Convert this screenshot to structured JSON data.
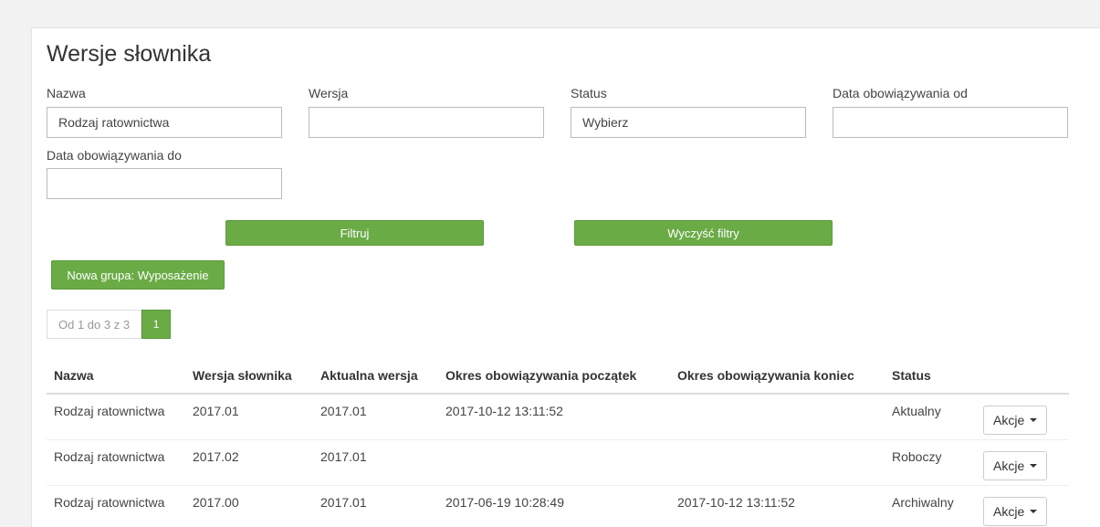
{
  "page_title": "Wersje słownika",
  "filters": {
    "nazwa_label": "Nazwa",
    "nazwa_value": "Rodzaj ratownictwa",
    "wersja_label": "Wersja",
    "wersja_value": "",
    "status_label": "Status",
    "status_value": "Wybierz",
    "od_label": "Data obowiązywania od",
    "od_value": "",
    "do_label": "Data obowiązywania do",
    "do_value": ""
  },
  "buttons": {
    "filter": "Filtruj",
    "clear": "Wyczyść filtry",
    "new_group": "Nowa grupa: Wyposażenie"
  },
  "pagination": {
    "info": "Od 1 do 3 z 3",
    "current": "1"
  },
  "table": {
    "headers": [
      "Nazwa",
      "Wersja słownika",
      "Aktualna wersja",
      "Okres obowiązywania początek",
      "Okres obowiązywania koniec",
      "Status"
    ],
    "rows": [
      {
        "nazwa": "Rodzaj ratownictwa",
        "wersja": "2017.01",
        "aktualna": "2017.01",
        "poczatek": "2017-10-12 13:11:52",
        "koniec": "",
        "status": "Aktualny",
        "action": "Akcje"
      },
      {
        "nazwa": "Rodzaj ratownictwa",
        "wersja": "2017.02",
        "aktualna": "2017.01",
        "poczatek": "",
        "koniec": "",
        "status": "Roboczy",
        "action": "Akcje"
      },
      {
        "nazwa": "Rodzaj ratownictwa",
        "wersja": "2017.00",
        "aktualna": "2017.01",
        "poczatek": "2017-06-19 10:28:49",
        "koniec": "2017-10-12 13:11:52",
        "status": "Archiwalny",
        "action": "Akcje"
      }
    ]
  },
  "colors": {
    "accent": "#6aab46"
  }
}
